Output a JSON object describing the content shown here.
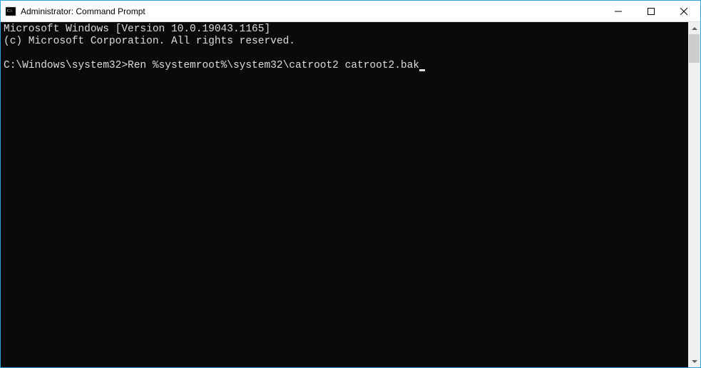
{
  "titlebar": {
    "title": "Administrator: Command Prompt"
  },
  "terminal": {
    "line1": "Microsoft Windows [Version 10.0.19043.1165]",
    "line2": "(c) Microsoft Corporation. All rights reserved.",
    "blank": "",
    "prompt": "C:\\Windows\\system32>",
    "command": "Ren %systemroot%\\system32\\catroot2 catroot2.bak"
  }
}
